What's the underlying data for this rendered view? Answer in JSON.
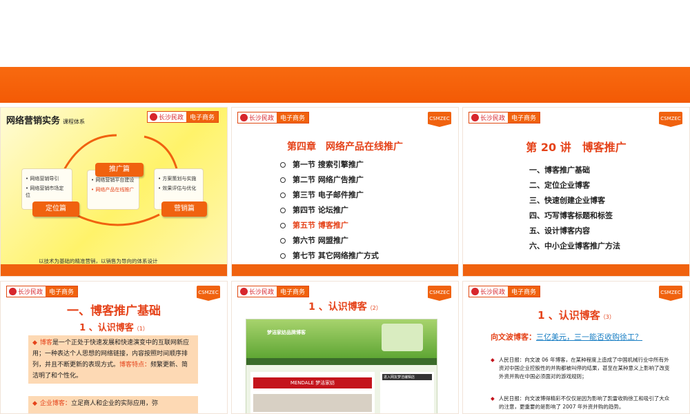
{
  "colors": {
    "accent": "#f0620f",
    "title_red": "#e5431a"
  },
  "common": {
    "logo_cn": "长沙民政",
    "logo_tag": "电子商务",
    "csm": "CSMZEC"
  },
  "s1": {
    "title": "网络营销实务",
    "subtitle": "课程体系",
    "center_pill": "推广篇",
    "left_pill": "定位篇",
    "right_pill": "营销篇",
    "left_items": [
      "网络营销导引",
      "网络营销市场定位"
    ],
    "center_items": [
      "网络营销平台建设",
      "网络产品在线推广"
    ],
    "right_items": [
      "方案策划与实施",
      "效果评估与优化"
    ],
    "footer": "以技术为基础的精准营销，以销售为导向的体系设计"
  },
  "s2": {
    "title": "第四章　网络产品在线推广",
    "items": [
      "第一节  搜索引擎推广",
      "第二节  网络广告推广",
      "第三节  电子邮件推广",
      "第四节  论坛推广",
      "第五节  博客推广",
      "第六节  网盟推广",
      "第七节  其它网络推广方式"
    ]
  },
  "s3": {
    "title": "第 20 讲　博客推广",
    "items": [
      "一、博客推广基础",
      "二、定位企业博客",
      "三、快速创建企业博客",
      "四、巧写博客标题和标签",
      "五、设计博客内容",
      "六、中小企业博客推广方法"
    ]
  },
  "s4": {
    "title": "一、博客推广基础",
    "sub": "1 、认识博客",
    "sub_small": "（1）",
    "p1_term": "博客",
    "p1": "是一个正处于快速发展和快速演变中的互联网新应用；一种表达个人思想的网络链接，内容按照时间顺序排列，并且不断更新的表现方式。",
    "p1_term2": "博客特点：",
    "p1_tail": "频繁更新、简洁明了和个性化。",
    "p2_term": "企业博客：",
    "p2": "立足商人和企业的实际应用，弥"
  },
  "s5": {
    "title": "1 、认识博客",
    "title_small": "（2）",
    "shot_header": "梦洁家纺品牌博客",
    "shot_banner": "MENDALE 梦洁家纺",
    "shot_side": "进入网友梦洁编辑店"
  },
  "s6": {
    "title": "1 、认识博客",
    "title_small": "（3）",
    "q_label": "向文波博客：",
    "q_link": "三亿美元，三一能否收购徐工？",
    "b1": "人民日报：向文波 06 年博客，在某种程度上造成了中国机械行业中所有外资对中国企业控股性的并购都被叫停的结果，甚至在某种意义上影响了改变外资并购在中国必须面对的游戏规则；",
    "b2": "人民日报：向文波博得精彩不仅仅是因为影响了凯雷收购徐工和吸引了大众的注意，更重要的是影响了 2007 年外资并购的趋势。"
  }
}
